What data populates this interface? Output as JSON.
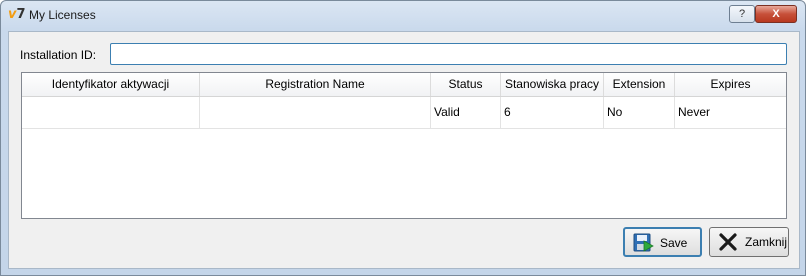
{
  "window": {
    "title": "My Licenses",
    "app_icon_text": "7",
    "help_label": "?",
    "close_label": "X"
  },
  "installation": {
    "label": "Installation ID:",
    "value": "",
    "placeholder": ""
  },
  "table": {
    "columns": [
      "Identyfikator aktywacji",
      "Registration Name",
      "Status",
      "Stanowiska pracy",
      "Extension",
      "Expires"
    ],
    "rows": [
      {
        "activation_id": "",
        "registration_name": "",
        "status": "Valid",
        "workstations": "6",
        "extension": "No",
        "expires": "Never"
      }
    ]
  },
  "buttons": {
    "save": "Save",
    "close": "Zamknij"
  },
  "icons": {
    "app": "v7-logo-icon",
    "save": "floppy-disk-icon",
    "close": "x-close-icon"
  },
  "colors": {
    "accent": "#3c7fb1",
    "close_red": "#c7503a",
    "save_green": "#2eaa3c"
  }
}
